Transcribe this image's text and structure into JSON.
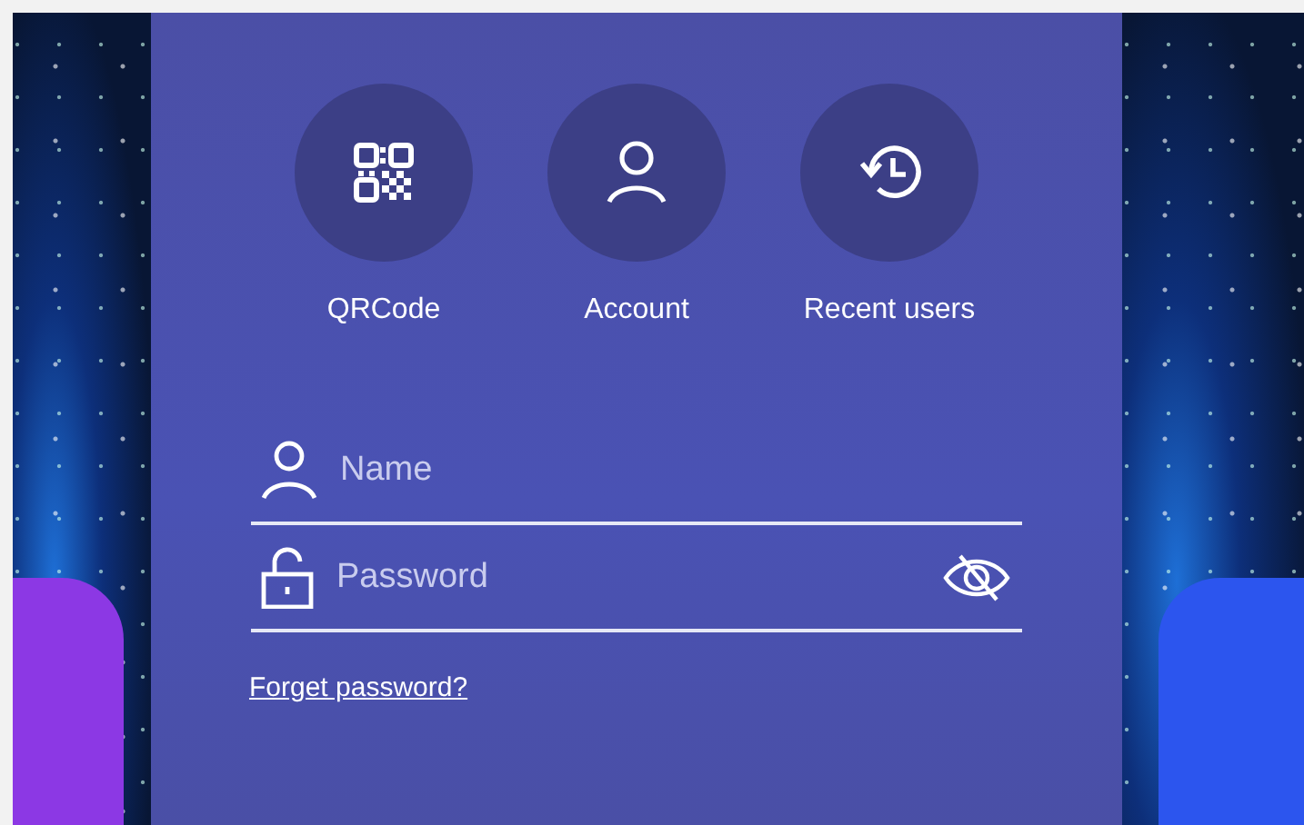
{
  "login_options": [
    {
      "label": "QRCode",
      "kind": "qrcode"
    },
    {
      "label": "Account",
      "kind": "account"
    },
    {
      "label": "Recent users",
      "kind": "history"
    }
  ],
  "fields": [
    {
      "kind": "name",
      "placeholder": "Name"
    },
    {
      "kind": "password",
      "placeholder": "Password",
      "password_visible": false
    }
  ],
  "forgot_link": "Forget password?",
  "app_tiles": [
    {
      "kind": "left",
      "color": "#8c38e4"
    },
    {
      "kind": "right",
      "color": "#2c55ee"
    }
  ]
}
